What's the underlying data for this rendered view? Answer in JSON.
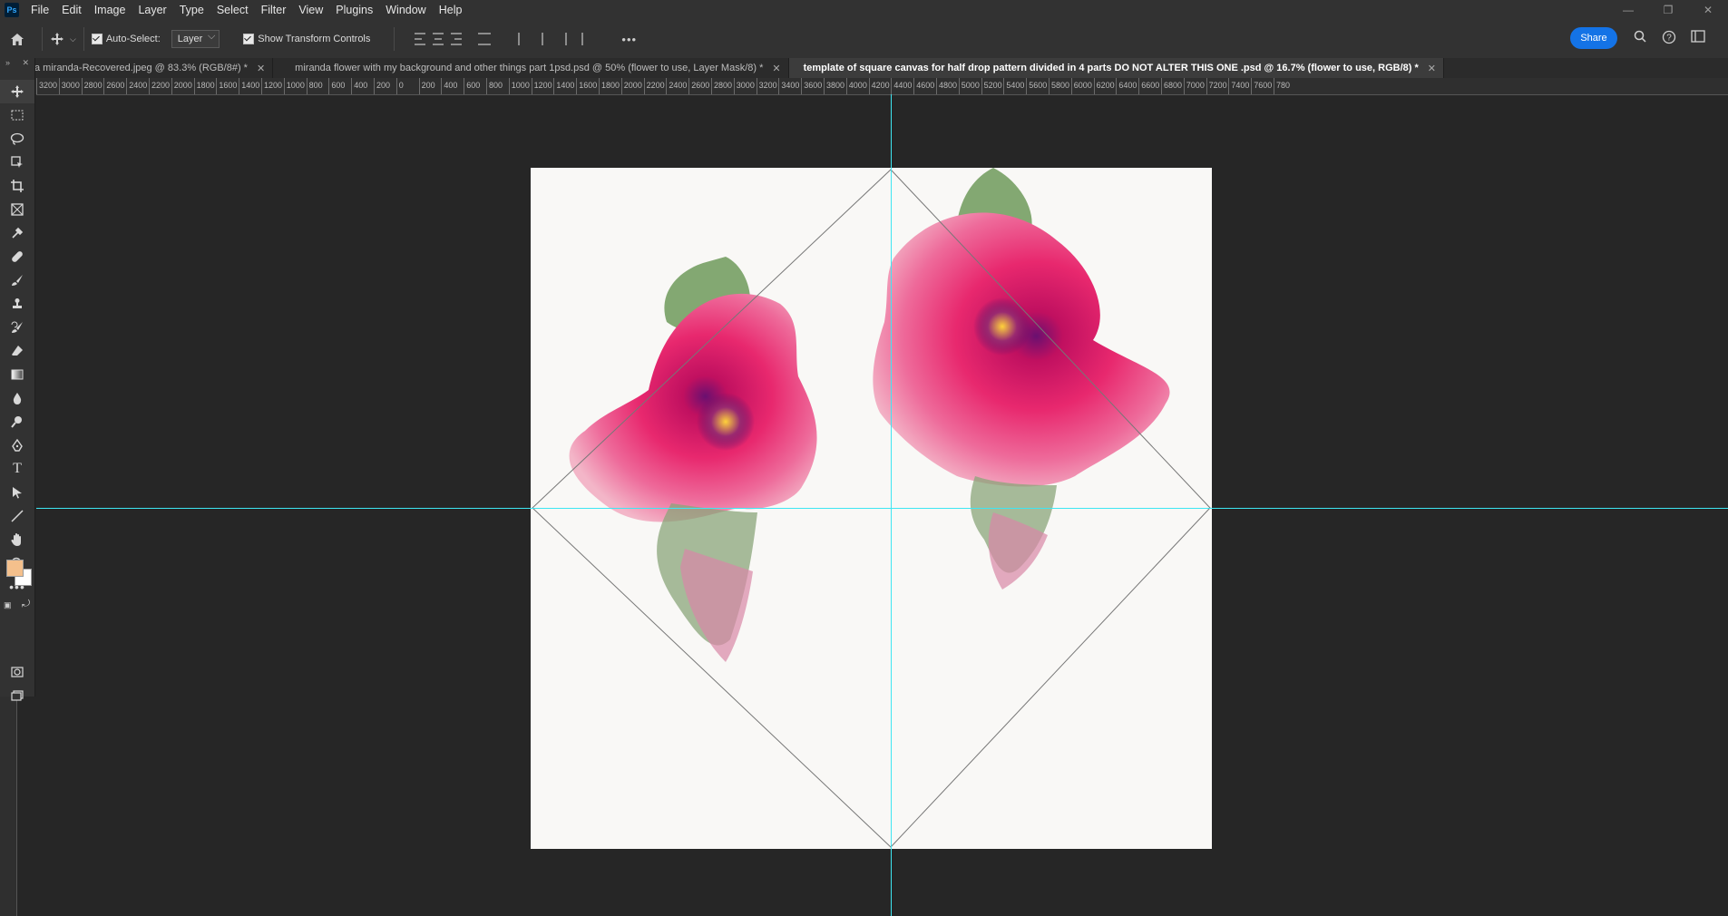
{
  "menu": {
    "logo": "Ps",
    "items": [
      "File",
      "Edit",
      "Image",
      "Layer",
      "Type",
      "Select",
      "Filter",
      "View",
      "Plugins",
      "Window",
      "Help"
    ]
  },
  "window_controls": [
    "—",
    "❐",
    "✕"
  ],
  "options": {
    "auto_select_label": "Auto-Select:",
    "auto_select_value": "Layer",
    "show_transform_label": "Show Transform Controls",
    "more": "•••",
    "share_label": "Share"
  },
  "tabs": [
    {
      "label": "a miranda-Recovered.jpeg @ 83.3% (RGB/8#) *",
      "close": "✕"
    },
    {
      "label": "miranda flower with my background and other things part 1psd.psd @ 50% (flower to use, Layer Mask/8) *",
      "close": "✕"
    },
    {
      "label": "template of square canvas for half drop pattern divided in 4 parts DO NOT ALTER THIS ONE .psd @ 16.7% (flower to use, RGB/8) *",
      "close": "✕"
    }
  ],
  "ruler": {
    "labels": [
      "3200",
      "3000",
      "2800",
      "2600",
      "2400",
      "2200",
      "2000",
      "1800",
      "1600",
      "1400",
      "1200",
      "1000",
      "800",
      "600",
      "400",
      "200",
      "0",
      "200",
      "400",
      "600",
      "800",
      "1000",
      "1200",
      "1400",
      "1600",
      "1800",
      "2000",
      "2200",
      "2400",
      "2600",
      "2800",
      "3000",
      "3200",
      "3400",
      "3600",
      "3800",
      "4000",
      "4200",
      "4400",
      "4600",
      "4800",
      "5000",
      "5200",
      "5400",
      "5600",
      "5800",
      "6000",
      "6200",
      "6400",
      "6600",
      "6800",
      "7000",
      "7200",
      "7400",
      "7600",
      "780"
    ]
  },
  "colors": {
    "foreground": "#f4c08c",
    "background": "#ffffff",
    "guide": "#3ee6f2",
    "accent": "#1473e6"
  }
}
